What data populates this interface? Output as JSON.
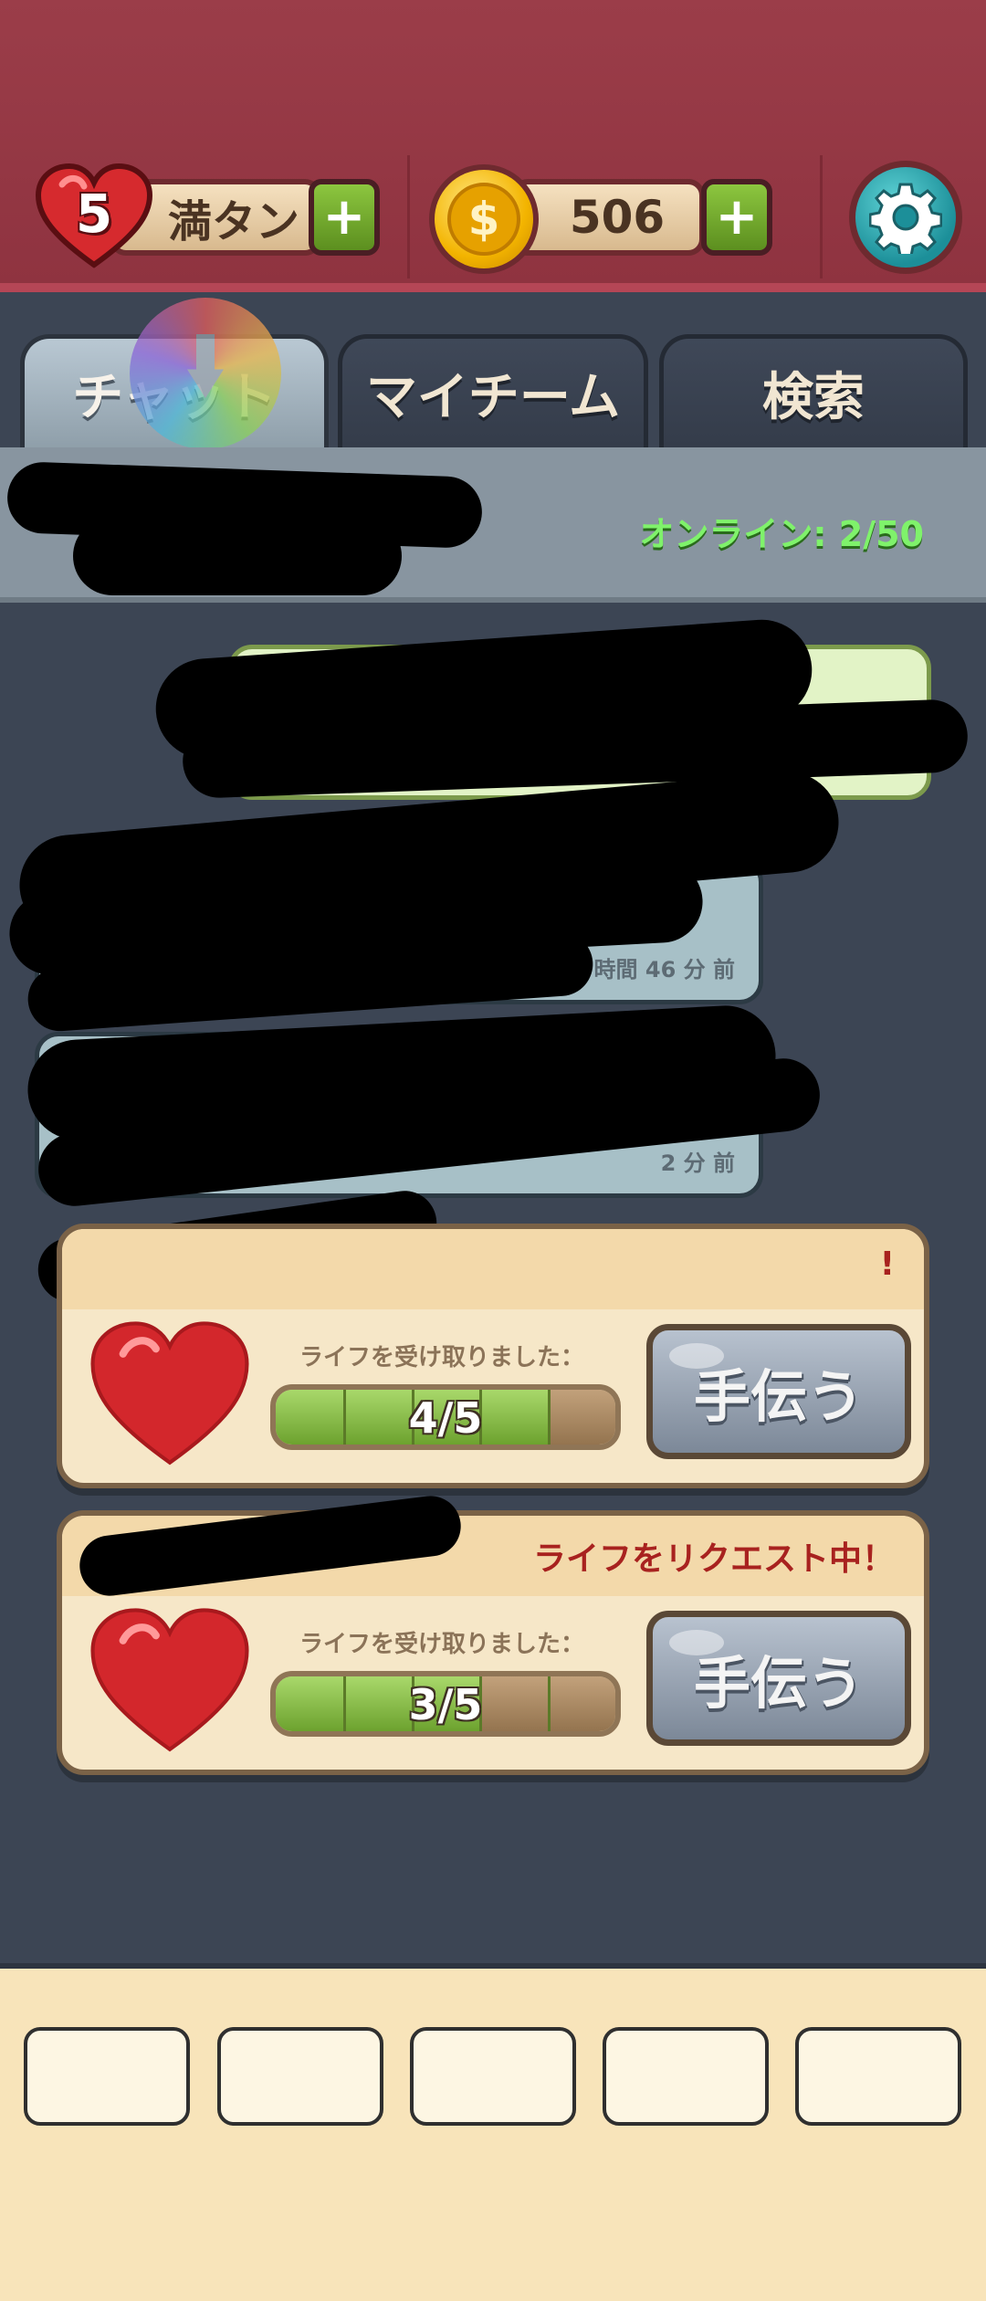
{
  "header": {
    "lives": {
      "count": "5",
      "status": "満タン",
      "icon": "heart-icon"
    },
    "coins": {
      "amount": "506",
      "icon": "dollar-coin-icon"
    },
    "add_label": "+",
    "settings_icon": "gear-icon"
  },
  "tabs": [
    {
      "label": "チャット",
      "active": true
    },
    {
      "label": "マイチーム",
      "active": false
    },
    {
      "label": "検索",
      "active": false
    }
  ],
  "team": {
    "online_label": "オンライン:",
    "online_count": "2/50"
  },
  "messages": [
    {
      "type": "mine"
    },
    {
      "type": "other",
      "time": "1 時間 46 分 前"
    },
    {
      "type": "other",
      "time": "2 分 前"
    }
  ],
  "life_requests": [
    {
      "request_label": "!",
      "received_label": "ライフを受け取りました：",
      "progress": 0.8,
      "progress_text": "4/5",
      "help_label": "手伝う"
    },
    {
      "request_label": "ライフをリクエスト中！",
      "received_label": "ライフを受け取りました：",
      "progress": 0.6,
      "progress_text": "3/5",
      "help_label": "手伝う"
    }
  ],
  "colors": {
    "header_bg": "#9b3d49",
    "chat_bg": "#3c4554",
    "online_green": "#7ff26b",
    "request_red": "#a8221f",
    "bottom_bar": "#f8e4ba"
  }
}
